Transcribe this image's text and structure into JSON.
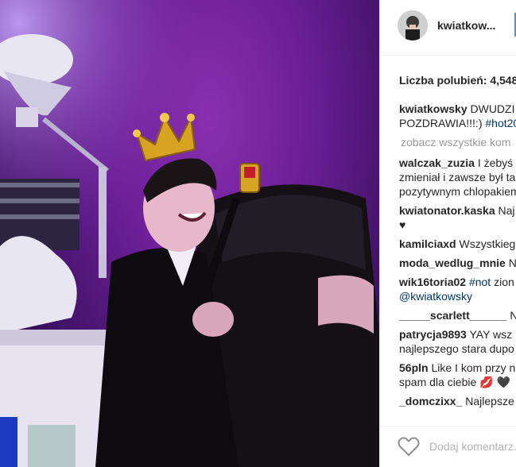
{
  "post": {
    "username": "kwiatkow...",
    "likes_text": "Liczba polubień: 4,548",
    "view_all": "zobacz wszystkie kom",
    "add_comment_placeholder": "Dodaj komentarz..."
  },
  "comments": [
    {
      "user": "kwiatkowsky",
      "lines": [
        "DWUDZI",
        "POZDRAWIA!!!:) "
      ],
      "tag": "#hot20"
    },
    {
      "user": "walczak_zuzia",
      "lines": [
        "I żebyś",
        "zmieniał i zawsze był ta",
        "pozytywnym chlopakiem"
      ]
    },
    {
      "user": "kwiatonator.kaska",
      "lines": [
        "Naj",
        "♥"
      ]
    },
    {
      "user": "kamilciaxd",
      "lines": [
        "Wszystkieg"
      ]
    },
    {
      "user": "moda_wedlug_mnie",
      "lines": [
        "N"
      ]
    },
    {
      "user": "wik16toria02",
      "lines": [
        " zion"
      ],
      "tag_before": "#not",
      "second_tag": "@kwiatkowsky"
    },
    {
      "user": "_____scarlett______",
      "lines": [
        "N"
      ]
    },
    {
      "user": "patrycja9893",
      "lines": [
        "YAY wsz",
        "najlepszego stara dupo"
      ]
    },
    {
      "user": "56pln",
      "lines": [
        "Like I kom przy n",
        "spam dla ciebie 💋 🖤"
      ]
    },
    {
      "user": "_domczixx_",
      "lines": [
        "Najlepsze"
      ]
    }
  ],
  "colors": {
    "accent": "#3897f0",
    "link": "#003569",
    "muted": "#999999",
    "text": "#262626"
  },
  "icons": {
    "like": "heart-outline-icon",
    "avatar": "profile-avatar"
  }
}
